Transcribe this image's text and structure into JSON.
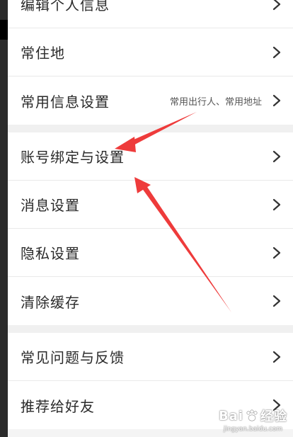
{
  "settings": {
    "group1": [
      {
        "label": "编辑个人信息",
        "sub": ""
      },
      {
        "label": "常住地",
        "sub": ""
      },
      {
        "label": "常用信息设置",
        "sub": "常用出行人、常用地址"
      }
    ],
    "group2": [
      {
        "label": "账号绑定与设置",
        "sub": ""
      },
      {
        "label": "消息设置",
        "sub": ""
      },
      {
        "label": "隐私设置",
        "sub": ""
      },
      {
        "label": "清除缓存",
        "sub": ""
      }
    ],
    "group3": [
      {
        "label": "常见问题与反馈",
        "sub": ""
      },
      {
        "label": "推荐给好友",
        "sub": ""
      }
    ]
  },
  "watermark": {
    "brand": "Bai",
    "brand_suffix": "经验",
    "url": "jingyan.baidu.com"
  },
  "colors": {
    "annotation_arrow": "#ee3b3b"
  }
}
